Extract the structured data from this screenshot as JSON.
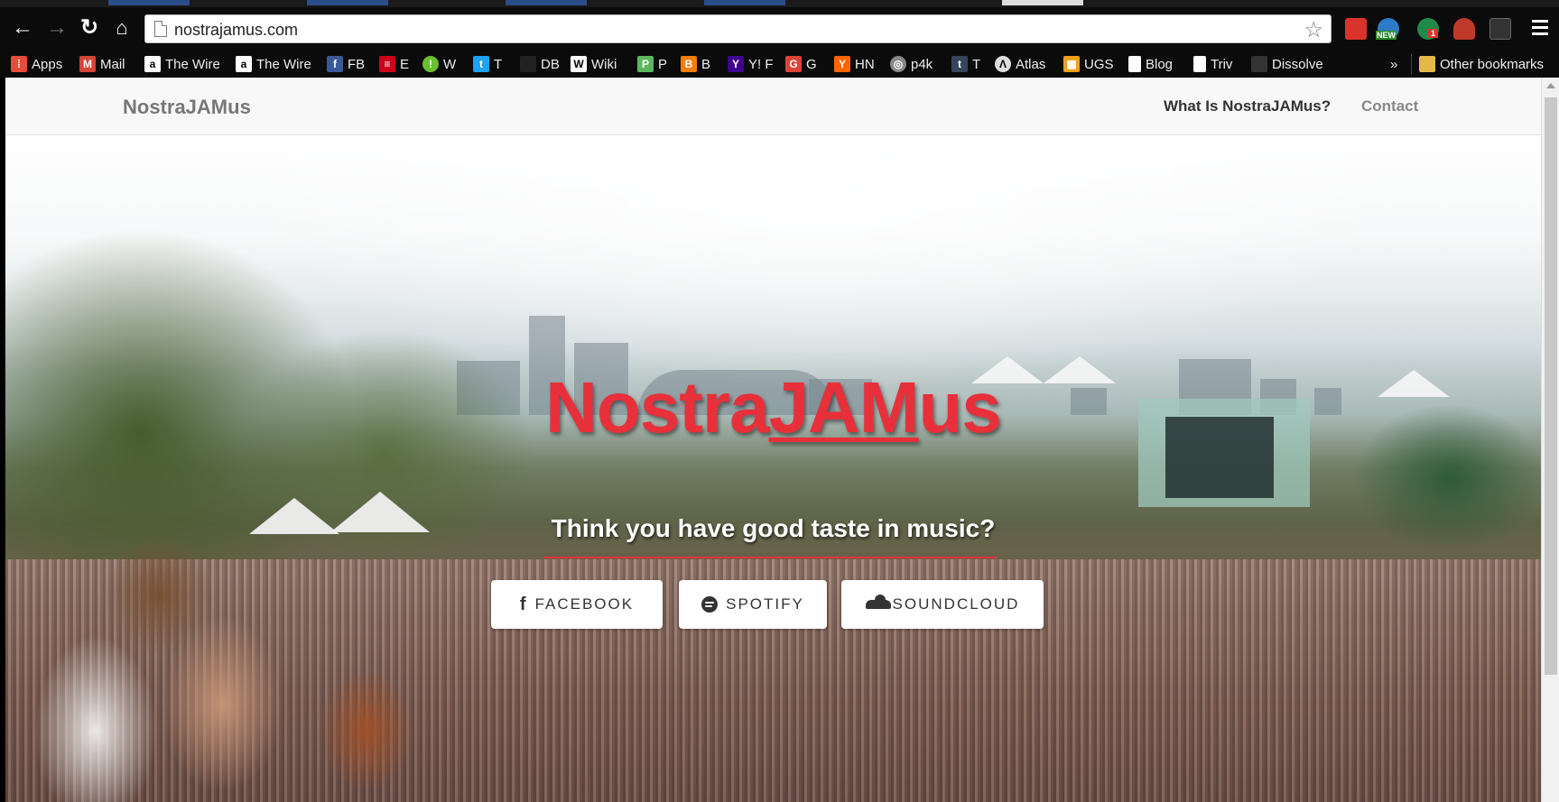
{
  "browser": {
    "url": "nostrajamus.com",
    "bookmarks": [
      {
        "label": "Apps",
        "icon": "apps-grid-icon",
        "color": "#e84b3c"
      },
      {
        "label": "Mail",
        "icon": "gmail-icon",
        "color": "#d44638"
      },
      {
        "label": "The Wire",
        "icon": "amazon-icon",
        "color": "#ffffff"
      },
      {
        "label": "The Wire",
        "icon": "amazon-icon",
        "color": "#ffffff"
      },
      {
        "label": "FB",
        "icon": "facebook-icon",
        "color": "#3b5998"
      },
      {
        "label": "E",
        "icon": "espn-icon",
        "color": "#d0021b"
      },
      {
        "label": "W",
        "icon": "w-icon",
        "color": "#6abf2e"
      },
      {
        "label": "T",
        "icon": "twitter-icon",
        "color": "#1da1f2"
      },
      {
        "label": "DB",
        "icon": "db-icon",
        "color": "#222222"
      },
      {
        "label": "Wiki",
        "icon": "wikipedia-icon",
        "color": "#ffffff"
      },
      {
        "label": "P",
        "icon": "p-icon",
        "color": "#5cb85c"
      },
      {
        "label": "B",
        "icon": "blogger-icon",
        "color": "#f57d00"
      },
      {
        "label": "Y! F",
        "icon": "yahoo-icon",
        "color": "#400090"
      },
      {
        "label": "G",
        "icon": "google-icon",
        "color": "#db4437"
      },
      {
        "label": "HN",
        "icon": "hacker-news-icon",
        "color": "#ff6600"
      },
      {
        "label": "p4k",
        "icon": "p4k-icon",
        "color": "#888888"
      },
      {
        "label": "T",
        "icon": "tumblr-icon",
        "color": "#35465c"
      },
      {
        "label": "Atlas",
        "icon": "atlas-icon",
        "color": "#dddddd"
      },
      {
        "label": "UGS",
        "icon": "ugs-icon",
        "color": "#f0a020"
      },
      {
        "label": "Blog",
        "icon": "page-icon",
        "color": "#ffffff"
      },
      {
        "label": "Triv",
        "icon": "page-icon",
        "color": "#ffffff"
      },
      {
        "label": "Dissolve",
        "icon": "dissolve-icon",
        "color": "#333333"
      }
    ],
    "overflow_label": "»",
    "other_bookmarks": "Other bookmarks",
    "ext_badge_new": "NEW",
    "ext_badge_count": "1"
  },
  "site": {
    "brand": "NostraJAMus",
    "nav": [
      {
        "label": "What Is NostraJAMus?"
      },
      {
        "label": "Contact"
      }
    ],
    "hero": {
      "title_pre": "Nostra",
      "title_u": "JAM",
      "title_post": "us",
      "subtitle": "Think you have good taste in music?",
      "buttons": [
        {
          "label": "FACEBOOK",
          "icon": "facebook-f-icon"
        },
        {
          "label": "SPOTIFY",
          "icon": "spotify-icon"
        },
        {
          "label": "SOUNDCLOUD",
          "icon": "soundcloud-icon"
        }
      ]
    },
    "colors": {
      "accent": "#e8303a",
      "nav_bg": "#f8f8f8"
    }
  }
}
